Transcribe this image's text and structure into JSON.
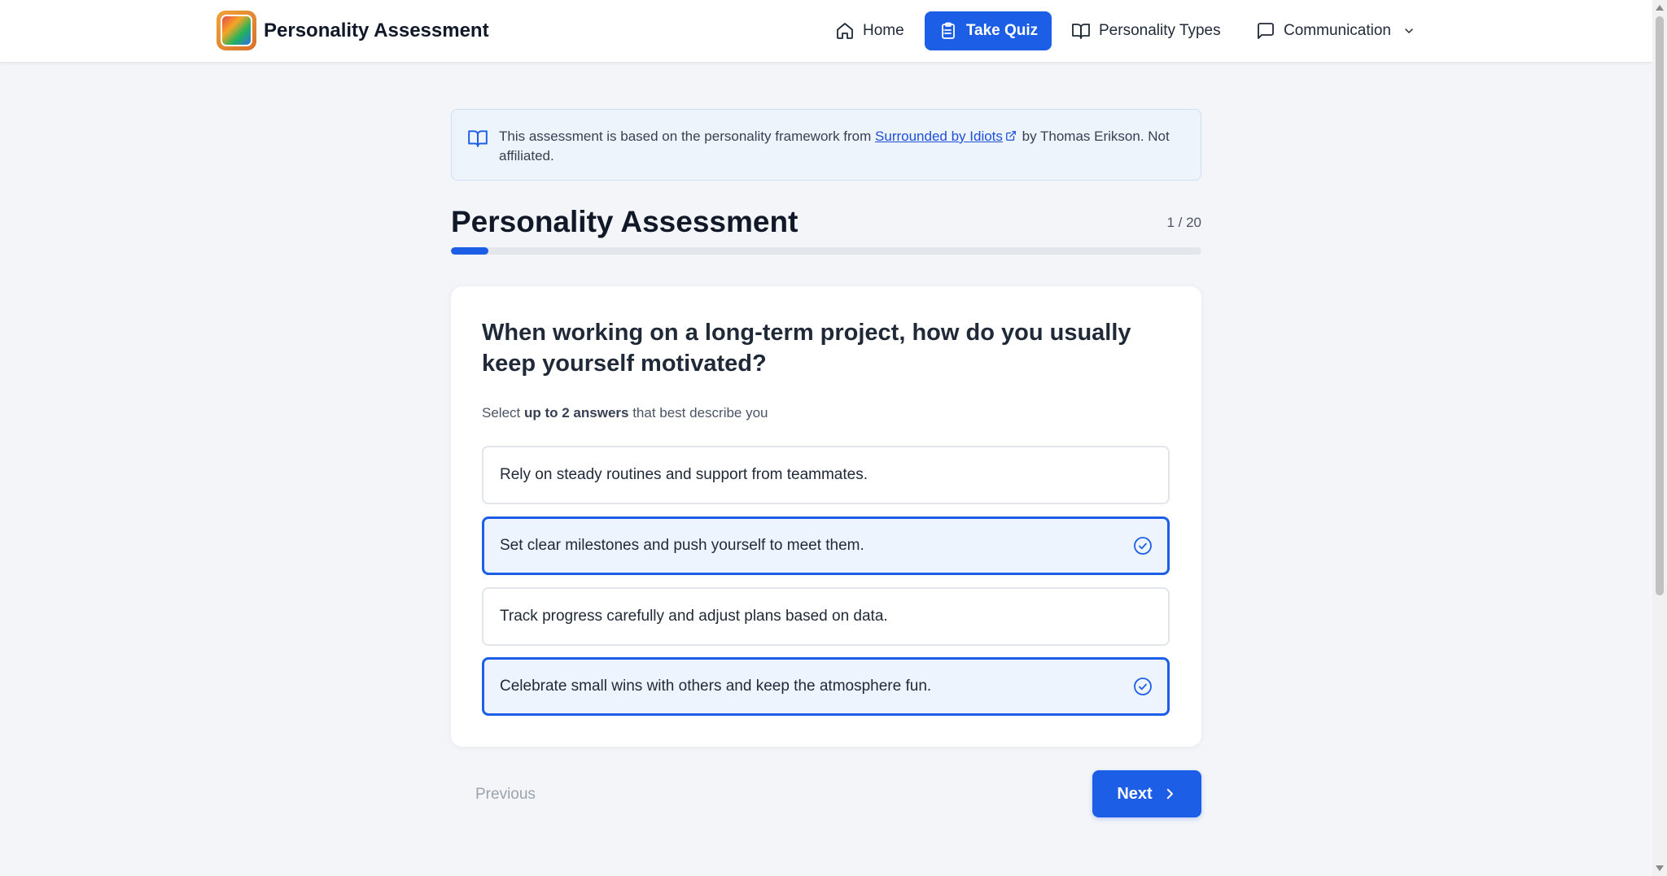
{
  "header": {
    "brand": "Personality Assessment",
    "nav": {
      "home": "Home",
      "take_quiz": "Take Quiz",
      "personality_types": "Personality Types",
      "communication": "Communication"
    }
  },
  "notice": {
    "text_before": "This assessment is based on the personality framework from ",
    "link_text": "Surrounded by Idiots",
    "text_after": " by Thomas Erikson. Not affiliated."
  },
  "quiz": {
    "title": "Personality Assessment",
    "counter": "1 / 20",
    "progress_fraction": 0.05,
    "question": "When working on a long-term project, how do you usually keep yourself motivated?",
    "instruction_before": "Select ",
    "instruction_bold": "up to 2 answers",
    "instruction_after": " that best describe you",
    "options": [
      {
        "label": "Rely on steady routines and support from teammates.",
        "selected": false
      },
      {
        "label": "Set clear milestones and push yourself to meet them.",
        "selected": true
      },
      {
        "label": "Track progress carefully and adjust plans based on data.",
        "selected": false
      },
      {
        "label": "Celebrate small wins with others and keep the atmosphere fun.",
        "selected": true
      }
    ],
    "previous_label": "Previous",
    "next_label": "Next"
  },
  "colors": {
    "accent": "#1d5ee6",
    "selected_bg": "#eef4fd",
    "notice_bg": "#eef4fc"
  }
}
